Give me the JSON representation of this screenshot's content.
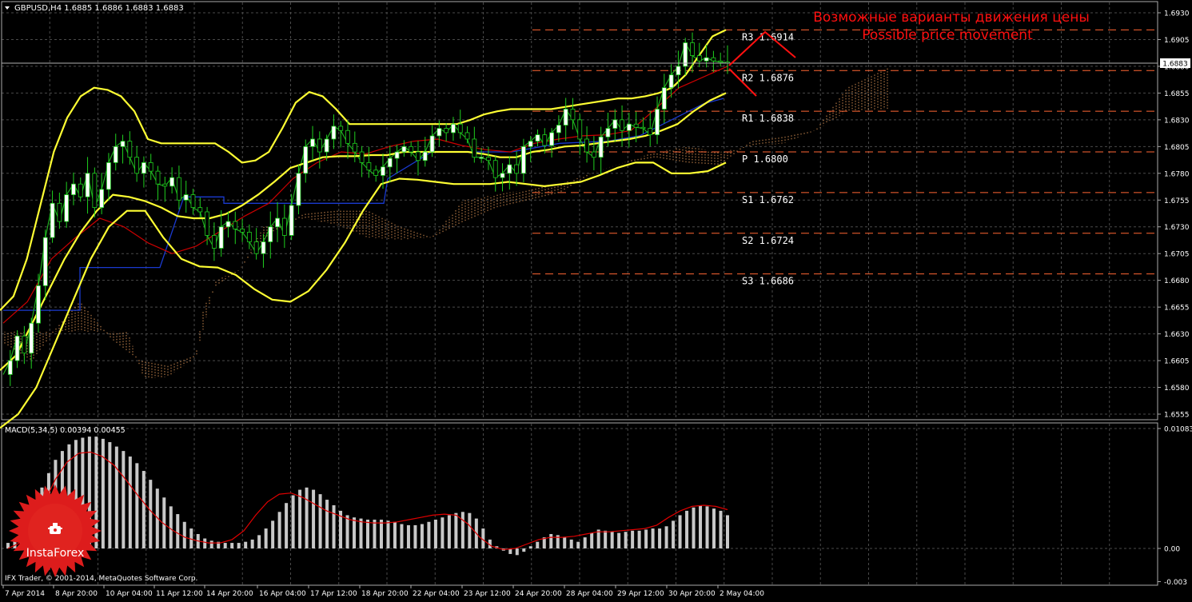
{
  "header": {
    "symbol_text": "GBPUSD,H4  1.6885 1.6886 1.6883 1.6883",
    "current_price": "1.6883"
  },
  "annotation": {
    "line1": "Возможные варианты движения цены",
    "line2": "Possible price movement"
  },
  "indicator_panel": {
    "label": "MACD(5,34,5) 0.00394 0.00455",
    "scale_labels": [
      "0.01083",
      "0.00",
      "-0.003"
    ]
  },
  "copyright": "IFX Trader, © 2001-2014, MetaQuotes Software Corp.",
  "logo_text": "InstaForex",
  "colors": {
    "background": "#000000",
    "grid": "#4a4a4a",
    "bollinger": "#ffff33",
    "close_line": "#1faa1f",
    "red_line": "#cc0000",
    "blue_line": "#1a3ad0",
    "cloud": "#f4a460",
    "levels": "#ff6633",
    "annotation": "#ff1010",
    "macd_hist": "#c8c8c8",
    "macd_signal": "#e00000",
    "logo": "#dd1c1c"
  },
  "chart_data": [
    {
      "type": "line",
      "title": "GBPUSD,H4",
      "ylim": [
        1.6547,
        1.6924
      ],
      "y_ticks": [
        "1.6930",
        "1.6905",
        "1.6880",
        "1.6855",
        "1.6830",
        "1.6805",
        "1.6780",
        "1.6755",
        "1.6730",
        "1.6705",
        "1.6680",
        "1.6655",
        "1.6630",
        "1.6605",
        "1.6580",
        "1.6555"
      ],
      "x_ticks": [
        "7 Apr 2014",
        "8 Apr 20:00",
        "10 Apr 04:00",
        "11 Apr 12:00",
        "14 Apr 20:00",
        "16 Apr 04:00",
        "17 Apr 12:00",
        "18 Apr 20:00",
        "22 Apr 04:00",
        "23 Apr 12:00",
        "24 Apr 20:00",
        "28 Apr 04:00",
        "29 Apr 12:00",
        "30 Apr 20:00",
        "2 May 04:00"
      ],
      "pivot_levels": [
        {
          "label": "R3 1.6914",
          "value": 1.6914
        },
        {
          "label": "R2 1.6876",
          "value": 1.6876
        },
        {
          "label": "R1 1.6838",
          "value": 1.6838
        },
        {
          "label": "P 1.6800",
          "value": 1.68
        },
        {
          "label": "S1 1.6762",
          "value": 1.6762
        },
        {
          "label": "S2 1.6724",
          "value": 1.6724
        },
        {
          "label": "S3 1.6686",
          "value": 1.6686
        }
      ],
      "close_series": [
        1.6592,
        1.6605,
        1.6628,
        1.6612,
        1.664,
        1.6675,
        1.672,
        1.6752,
        1.6735,
        1.676,
        1.677,
        1.6758,
        1.678,
        1.6748,
        1.6765,
        1.679,
        1.6805,
        1.681,
        1.6795,
        1.678,
        1.679,
        1.6782,
        1.677,
        1.6768,
        1.6776,
        1.6755,
        1.676,
        1.6748,
        1.6744,
        1.6722,
        1.671,
        1.673,
        1.6735,
        1.6728,
        1.6725,
        1.6716,
        1.6705,
        1.6716,
        1.673,
        1.6738,
        1.6722,
        1.675,
        1.678,
        1.6805,
        1.6812,
        1.68,
        1.6812,
        1.6824,
        1.682,
        1.6808,
        1.68,
        1.679,
        1.6783,
        1.6778,
        1.6786,
        1.6794,
        1.68,
        1.6805,
        1.68,
        1.6792,
        1.68,
        1.6815,
        1.6822,
        1.6818,
        1.6826,
        1.6818,
        1.6812,
        1.6795,
        1.6795,
        1.6792,
        1.6776,
        1.678,
        1.6788,
        1.678,
        1.6805,
        1.681,
        1.6816,
        1.6806,
        1.6818,
        1.6825,
        1.684,
        1.683,
        1.6812,
        1.68,
        1.6795,
        1.6814,
        1.6822,
        1.683,
        1.682,
        1.6826,
        1.6823,
        1.6822,
        1.6816,
        1.684,
        1.686,
        1.6872,
        1.688,
        1.6902,
        1.689,
        1.6885,
        1.6888,
        1.6885,
        1.6884,
        1.6883
      ],
      "bb_upper": [
        1.6652,
        1.6665,
        1.67,
        1.675,
        1.68,
        1.6832,
        1.6852,
        1.686,
        1.6858,
        1.6852,
        1.6838,
        1.6812,
        1.6808,
        1.6808,
        1.6808,
        1.6808,
        1.6808,
        1.68,
        1.679,
        1.6792,
        1.68,
        1.6822,
        1.6846,
        1.6856,
        1.6852,
        1.684,
        1.6826,
        1.6826,
        1.6826,
        1.6826,
        1.6826,
        1.6826,
        1.6826,
        1.6826,
        1.6826,
        1.683,
        1.6835,
        1.6838,
        1.684,
        1.684,
        1.684,
        1.684,
        1.6842,
        1.6844,
        1.6846,
        1.6848,
        1.685,
        1.685,
        1.6852,
        1.6855,
        1.686,
        1.6872,
        1.689,
        1.6908,
        1.6914
      ],
      "bb_mid": [
        1.6596,
        1.661,
        1.664,
        1.667,
        1.67,
        1.6725,
        1.6745,
        1.676,
        1.6758,
        1.6754,
        1.6748,
        1.674,
        1.6738,
        1.6738,
        1.6742,
        1.675,
        1.676,
        1.6772,
        1.6785,
        1.679,
        1.6795,
        1.6796,
        1.6796,
        1.6797,
        1.6797,
        1.68,
        1.68,
        1.68,
        1.68,
        1.68,
        1.6798,
        1.6795,
        1.6795,
        1.68,
        1.6802,
        1.6805,
        1.6806,
        1.6808,
        1.681,
        1.6812,
        1.6815,
        1.682,
        1.6826,
        1.6838,
        1.6848,
        1.6855
      ],
      "bb_lower": [
        1.6542,
        1.6555,
        1.658,
        1.662,
        1.666,
        1.67,
        1.673,
        1.6745,
        1.6745,
        1.672,
        1.67,
        1.6693,
        1.6692,
        1.6685,
        1.6672,
        1.6662,
        1.666,
        1.667,
        1.669,
        1.6715,
        1.6745,
        1.677,
        1.6775,
        1.6774,
        1.6772,
        1.677,
        1.677,
        1.677,
        1.6772,
        1.677,
        1.6768,
        1.677,
        1.6772,
        1.6778,
        1.6785,
        1.679,
        1.679,
        1.678,
        1.678,
        1.6782,
        1.679
      ]
    },
    {
      "type": "bar",
      "title": "MACD(5,34,5)",
      "ylim": [
        -0.003,
        0.01083
      ],
      "histogram": [
        0.0005,
        0.0008,
        0.0015,
        0.0025,
        0.004,
        0.0055,
        0.0068,
        0.008,
        0.0088,
        0.0094,
        0.0098,
        0.01,
        0.0101,
        0.0101,
        0.0099,
        0.0096,
        0.0092,
        0.0088,
        0.0083,
        0.0077,
        0.007,
        0.0062,
        0.0054,
        0.0046,
        0.0038,
        0.0031,
        0.0024,
        0.0018,
        0.0013,
        0.0009,
        0.0007,
        0.0006,
        0.0005,
        0.0005,
        0.0005,
        0.0006,
        0.0008,
        0.0012,
        0.0018,
        0.0025,
        0.0033,
        0.0041,
        0.0048,
        0.0053,
        0.0055,
        0.0053,
        0.0049,
        0.0044,
        0.0039,
        0.0034,
        0.003,
        0.0028,
        0.0027,
        0.0026,
        0.0026,
        0.0026,
        0.0025,
        0.0024,
        0.0022,
        0.0021,
        0.0021,
        0.0022,
        0.0024,
        0.0026,
        0.0028,
        0.003,
        0.0032,
        0.0033,
        0.0032,
        0.0027,
        0.0018,
        0.0008,
        0.0002,
        -0.0002,
        -0.0005,
        -0.0006,
        -0.0003,
        0.0002,
        0.0006,
        0.001,
        0.0013,
        0.0012,
        0.001,
        0.0008,
        0.0006,
        0.001,
        0.0014,
        0.0017,
        0.0016,
        0.0015,
        0.0014,
        0.0015,
        0.0016,
        0.0016,
        0.0017,
        0.0018,
        0.0018,
        0.002,
        0.0025,
        0.003,
        0.0034,
        0.0037,
        0.0039,
        0.0038,
        0.0036,
        0.0034,
        0.003
      ],
      "signal_line": [
        0.0,
        0.0005,
        0.0018,
        0.004,
        0.0062,
        0.0078,
        0.0086,
        0.0087,
        0.0083,
        0.0075,
        0.0062,
        0.0048,
        0.0035,
        0.0024,
        0.0016,
        0.001,
        0.0007,
        0.0005,
        0.0005,
        0.0008,
        0.0016,
        0.003,
        0.0042,
        0.0049,
        0.005,
        0.0046,
        0.004,
        0.0034,
        0.003,
        0.0026,
        0.0024,
        0.0023,
        0.0023,
        0.0024,
        0.0026,
        0.0028,
        0.003,
        0.0031,
        0.003,
        0.0022,
        0.001,
        0.0002,
        -0.0001,
        0.0,
        0.0004,
        0.0008,
        0.001,
        0.001,
        0.0011,
        0.0013,
        0.0015,
        0.0015,
        0.0016,
        0.0017,
        0.0018,
        0.0021,
        0.0028,
        0.0034,
        0.0038,
        0.0039,
        0.0038,
        0.0035
      ]
    }
  ]
}
